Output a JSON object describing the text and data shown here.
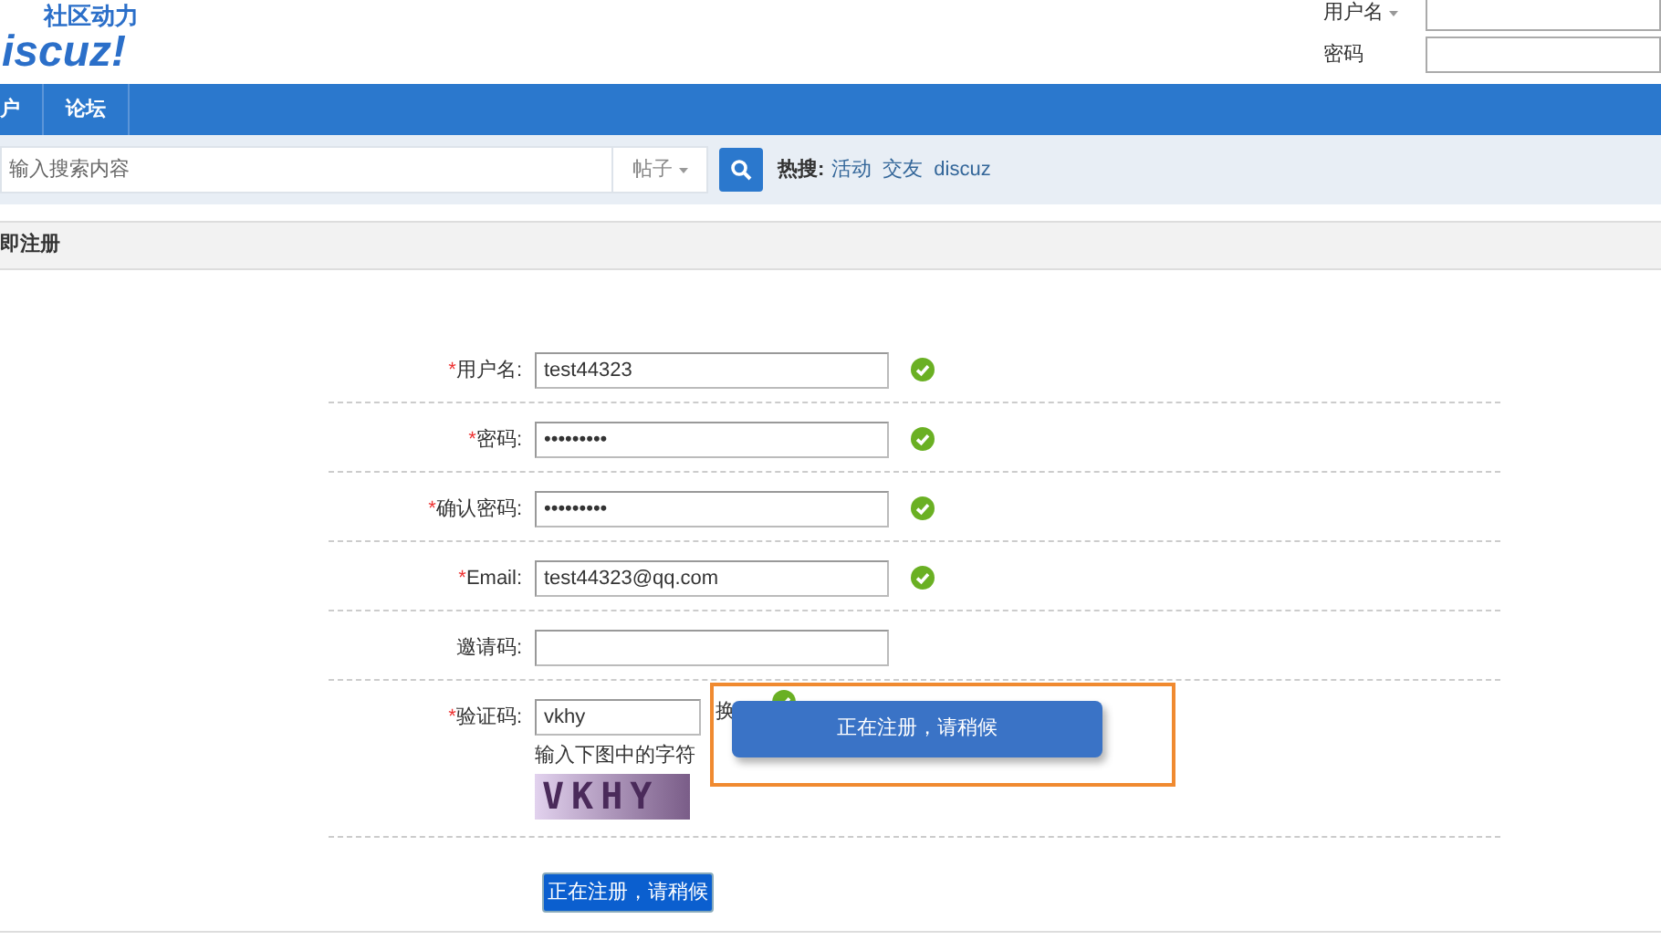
{
  "logo": {
    "tagline": "社区动力",
    "wordmark": "iscuz!"
  },
  "login": {
    "username_label": "用户名",
    "password_label": "密码"
  },
  "nav": [
    {
      "label": "户",
      "selected": false
    },
    {
      "label": "论坛",
      "selected": false
    }
  ],
  "search": {
    "placeholder": "输入搜索内容",
    "scope": "帖子",
    "hot_label": "热搜:",
    "hot_links": [
      "活动",
      "交友",
      "discuz"
    ]
  },
  "section_title": "即注册",
  "fields": [
    {
      "kind": "text",
      "asterisk": "*",
      "label": "用户名:",
      "value": "test44323",
      "valid": true
    },
    {
      "kind": "text",
      "asterisk": "*",
      "label": "密码:",
      "value": "•••••••••",
      "valid": true
    },
    {
      "kind": "text",
      "asterisk": "*",
      "label": "确认密码:",
      "value": "•••••••••",
      "valid": true
    },
    {
      "kind": "text",
      "asterisk": "*",
      "label": "Email:",
      "value": "test44323@qq.com",
      "valid": true
    },
    {
      "kind": "text",
      "label": "邀请码:",
      "valid": false
    },
    {
      "kind": "captcha",
      "asterisk": "*",
      "label": "验证码:",
      "value": "vkhy",
      "valid": true,
      "refresh": "换",
      "hint": "输入下图中的字符",
      "code": "VKHY"
    }
  ],
  "submit": "正在注册，请稍候",
  "popup": {
    "message": "正在注册，请稍候"
  }
}
